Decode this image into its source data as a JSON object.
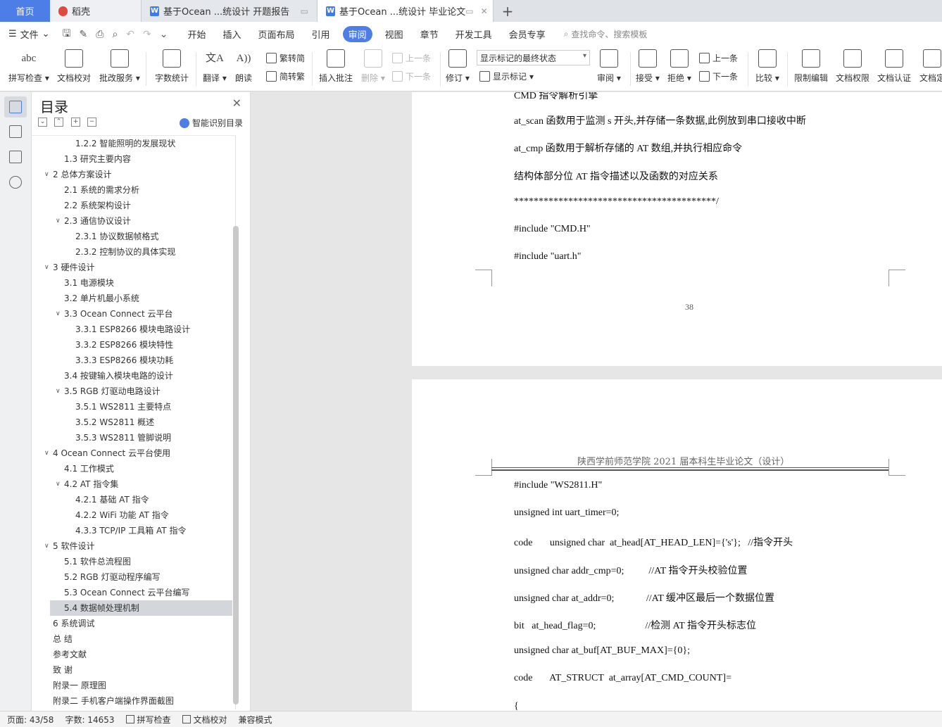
{
  "tabs": [
    {
      "label": "首页"
    },
    {
      "label": "稻壳"
    },
    {
      "label": "基于Ocean ...统设计 开题报告"
    },
    {
      "label": "基于Ocean ...统设计 毕业论文"
    }
  ],
  "menu": {
    "file": "文件",
    "items": [
      "开始",
      "插入",
      "页面布局",
      "引用",
      "审阅",
      "视图",
      "章节",
      "开发工具",
      "会员专享"
    ],
    "active": "审阅",
    "search": "查找命令、搜索模板"
  },
  "ribbon": {
    "spell": "拼写检查",
    "proofread": "文档校对",
    "batch": "批改服务",
    "wordcount": "字数统计",
    "translate": "翻译",
    "read": "朗读",
    "trad": "繁转简",
    "simp": "简转繁",
    "insert_comment": "插入批注",
    "delete": "删除",
    "prev": "上一条",
    "next": "下一条",
    "track": "修订",
    "markup_combo": "显示标记的最终状态",
    "show_markup": "显示标记",
    "review": "审阅",
    "accept": "接受",
    "reject": "拒绝",
    "prev2": "上一条",
    "next2": "下一条",
    "compare": "比较",
    "restrict": "限制编辑",
    "permission": "文档权限",
    "certify": "文档认证",
    "finalize": "文档定"
  },
  "toc": {
    "title": "目录",
    "smart": "智能识别目录",
    "items": [
      {
        "text": "1.2.2 智能照明的发展现状",
        "level": 3
      },
      {
        "text": "1.3  研究主要内容",
        "level": 2
      },
      {
        "text": "2  总体方案设计",
        "level": 1,
        "arrow": true
      },
      {
        "text": "2.1  系统的需求分析",
        "level": 2
      },
      {
        "text": "2.2  系统架构设计",
        "level": 2
      },
      {
        "text": "2.3  通信协议设计",
        "level": 2,
        "arrow": true
      },
      {
        "text": "2.3.1 协议数据帧格式",
        "level": 3
      },
      {
        "text": "2.3.2 控制协议的具体实现",
        "level": 3
      },
      {
        "text": "3  硬件设计",
        "level": 1,
        "arrow": true
      },
      {
        "text": "3.1  电源模块",
        "level": 2
      },
      {
        "text": "3.2  单片机最小系统",
        "level": 2
      },
      {
        "text": "3.3 Ocean Connect 云平台",
        "level": 2,
        "arrow": true
      },
      {
        "text": "3.3.1 ESP8266 模块电路设计",
        "level": 3
      },
      {
        "text": "3.3.2 ESP8266 模块特性",
        "level": 3
      },
      {
        "text": "3.3.3 ESP8266 模块功耗",
        "level": 3
      },
      {
        "text": "3.4  按键输入模块电路的设计",
        "level": 2
      },
      {
        "text": "3.5 RGB  灯驱动电路设计",
        "level": 2,
        "arrow": true
      },
      {
        "text": "3.5.1 WS2811 主要特点",
        "level": 3
      },
      {
        "text": "3.5.2 WS2811  概述",
        "level": 3
      },
      {
        "text": "3.5.3 WS2811  管脚说明",
        "level": 3
      },
      {
        "text": "4 Ocean Connect 云平台使用",
        "level": 1,
        "arrow": true
      },
      {
        "text": "4.1  工作模式",
        "level": 2
      },
      {
        "text": "4.2 AT 指令集",
        "level": 2,
        "arrow": true
      },
      {
        "text": "4.2.1  基础 AT 指令",
        "level": 3
      },
      {
        "text": "4.2.2 WiFi 功能 AT 指令",
        "level": 3
      },
      {
        "text": "4.3.3 TCP/IP 工具箱  AT 指令",
        "level": 3
      },
      {
        "text": "5  软件设计",
        "level": 1,
        "arrow": true
      },
      {
        "text": "5.1 软件总流程图",
        "level": 2
      },
      {
        "text": "5.2 RGB 灯驱动程序编写",
        "level": 2
      },
      {
        "text": "5.3 Ocean Connect 云平台编写",
        "level": 2
      },
      {
        "text": "5.4 数据帧处理机制",
        "level": 2,
        "selected": true
      },
      {
        "text": "6  系统调试",
        "level": 1
      },
      {
        "text": "总    结",
        "level": 1
      },
      {
        "text": "参考文献",
        "level": 1
      },
      {
        "text": "致    谢",
        "level": 1
      },
      {
        "text": "附录一  原理图",
        "level": 1
      },
      {
        "text": "附录二  手机客户端操作界面截图",
        "level": 1
      }
    ]
  },
  "page1": {
    "lines": [
      "CMD 指令解析引擎",
      "at_scan 函数用于监测 s 开头,并存储一条数据,此例放到串口接收中断",
      "at_cmp 函数用于解析存储的 AT 数组,并执行相应命令",
      "结构体部分位 AT 指令描述以及函数的对应关系",
      "*****************************************/",
      "#include \"CMD.H\"",
      "#include \"uart.h\""
    ],
    "page_number": "38"
  },
  "page2": {
    "header": "陕西学前师范学院  2021 届本科生毕业论文（设计）",
    "lines": [
      "#include \"WS2811.H\"",
      "unsigned int uart_timer=0;",
      "code       unsigned char  at_head[AT_HEAD_LEN]={'s'};   //指令开头",
      "unsigned char addr_cmp=0;          //AT 指令开头校验位置",
      "unsigned char at_addr=0;             //AT 缓冲区最后一个数据位置",
      "bit   at_head_flag=0;                    //检测 AT 指令开头标志位",
      "unsigned char at_buf[AT_BUF_MAX]={0};",
      "code       AT_STRUCT  at_array[AT_CMD_COUNT]=",
      "{"
    ]
  },
  "status": {
    "page": "页面: 43/58",
    "words": "字数: 14653",
    "spell": "拼写检查",
    "proof": "文档校对",
    "compat": "兼容模式"
  }
}
